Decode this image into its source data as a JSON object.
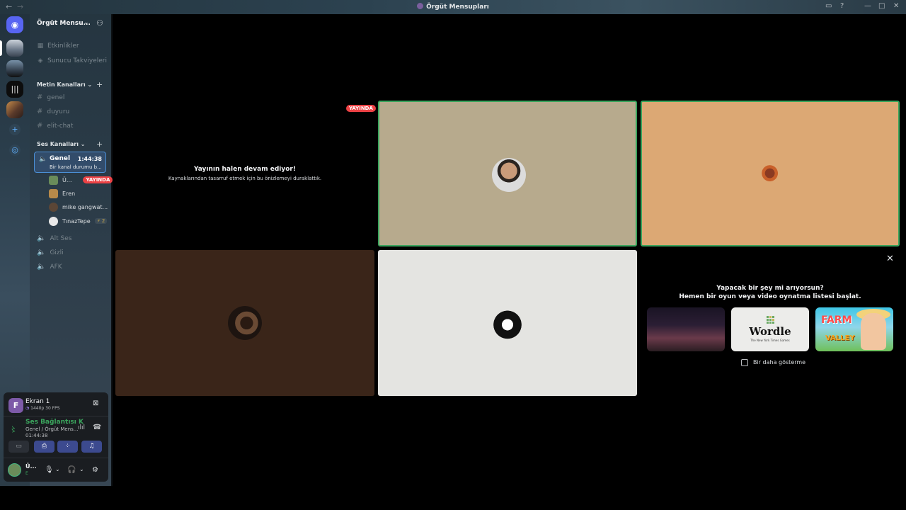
{
  "window": {
    "title": "Örgüt Mensupları"
  },
  "server": {
    "name": "Örgüt Mensu..."
  },
  "nav": {
    "events": "Etkinlikler",
    "boosts": "Sunucu Takviyeleri"
  },
  "text_category": {
    "label": "Metin Kanalları",
    "channels": [
      "genel",
      "duyuru",
      "elit-chat"
    ]
  },
  "voice_category": {
    "label": "Ses Kanalları"
  },
  "active_voice": {
    "name": "Genel",
    "time": "1:44:38",
    "status": "Bir kanal durumu b..."
  },
  "voice_users": [
    {
      "name": "Ü...",
      "live": "YAYINDA",
      "color": "#6a8c5a"
    },
    {
      "name": "Eren",
      "color": "#b88a4a"
    },
    {
      "name": "mike gangwat...",
      "color": "#5b4636"
    },
    {
      "name": "TınazTepe",
      "tag": "⚡ 2",
      "color": "#e8e8e8"
    }
  ],
  "other_voice": [
    "Alt Ses",
    "Gizli",
    "AFK"
  ],
  "panel": {
    "screen_avatar": "F",
    "screen_title": "Ekran 1",
    "screen_sub": "1440p 30 FPS",
    "conn_label": "Ses Bağlantısı K",
    "conn_channel": "Genel / Örgüt Mens...",
    "conn_time": "01:44:38",
    "user_name": "Ü...",
    "user_status": "E"
  },
  "stage": {
    "live_badge": "YAYINDA",
    "paused_title": "Yayının halen devam ediyor!",
    "paused_sub": "Kaynaklarından tasarruf etmek için bu önizlemeyi duraklattık."
  },
  "promo": {
    "line1": "Yapacak bir şey mi arıyorsun?",
    "line2": "Hemen bir oyun veya video oynatma listesi başlat.",
    "games": [
      "Wordle",
      "The New York Times Games",
      "FARM",
      "VALLEY"
    ],
    "dont_show": "Bir daha gösterme"
  },
  "colors": {
    "accent": "#5865f2",
    "live": "#ed4245",
    "speaking": "#3aa55d"
  }
}
